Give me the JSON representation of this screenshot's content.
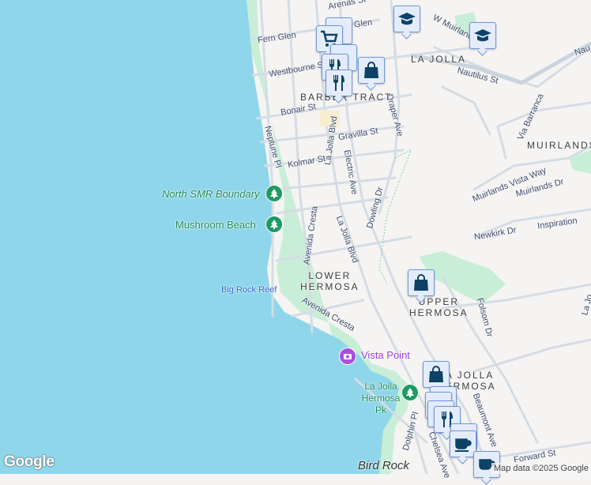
{
  "map": {
    "streets": {
      "arenas": "Arenas St",
      "fern_glen": "Fern Glen",
      "glen": "Glen",
      "westbourne": "Westbourne St",
      "w_muirlands": "W Muirlands",
      "nautilus": "Nautilus St",
      "nau": "Nau",
      "bonair": "Bonair St",
      "draper": "Draper Ave",
      "gravilla": "Gravilla St",
      "la_jolla_blvd_1": "La Jolla Blvd",
      "neptune": "Neptune Pl",
      "kolmar": "Kolmar St",
      "electric": "Electric Ave",
      "via_barranca": "Via Barranca",
      "muirlands_vista": "Muirlands Vista Way",
      "muirlands_dr": "Muirlands Dr",
      "avenida_cresta_1": "Avenida Cresta",
      "dowling": "Dowling Dr",
      "la_jolla_blvd_2": "La Jolla Blvd",
      "newkirk": "Newkirk Dr",
      "inspiration": "Inspiration",
      "folsom": "Folsom Dr",
      "la_jo": "La Jo",
      "avenida_cresta_2": "Avenida Cresta",
      "beaumont": "Beaumont Ave",
      "dolphin": "Dolphin Pl",
      "chelsea": "Chelsea Ave",
      "forward": "Forward St"
    },
    "areas": {
      "la_jolla": "LA JOLLA",
      "barber_tract": "BARBER TRACT",
      "muirlands": "MUIRLANDS",
      "lower_hermosa": "LOWER\nHERMOSA",
      "upper_hermosa": "UPPER\nHERMOSA",
      "la_jolla_hermosa": "LA JOLLA\nHERMOSA",
      "bird_rock": "Bird Rock"
    },
    "pois": {
      "north_smr": "North SMR Boundary",
      "mushroom_beach": "Mushroom Beach",
      "big_rock_reef": "Big Rock Reef",
      "vista_point": "Vista Point",
      "la_jolla_hermosa_pk": "La Jolla Hermosa Pk"
    },
    "colors": {
      "water": "#8fd6ea",
      "land": "#f5f4f3",
      "park": "#c9eed7",
      "marker_icon": "#0d4266"
    },
    "markers": [
      "school-icon",
      "school-icon",
      "shopping-cart-icon",
      "restaurant-icon",
      "restaurant-icon",
      "shopping-bag-icon",
      "shopping-bag-icon",
      "shopping-bag-icon",
      "restaurant-icon",
      "cafe-icon",
      "cafe-icon"
    ]
  },
  "footer": {
    "logo": "Google",
    "attribution": "Map data ©2025 Google"
  }
}
